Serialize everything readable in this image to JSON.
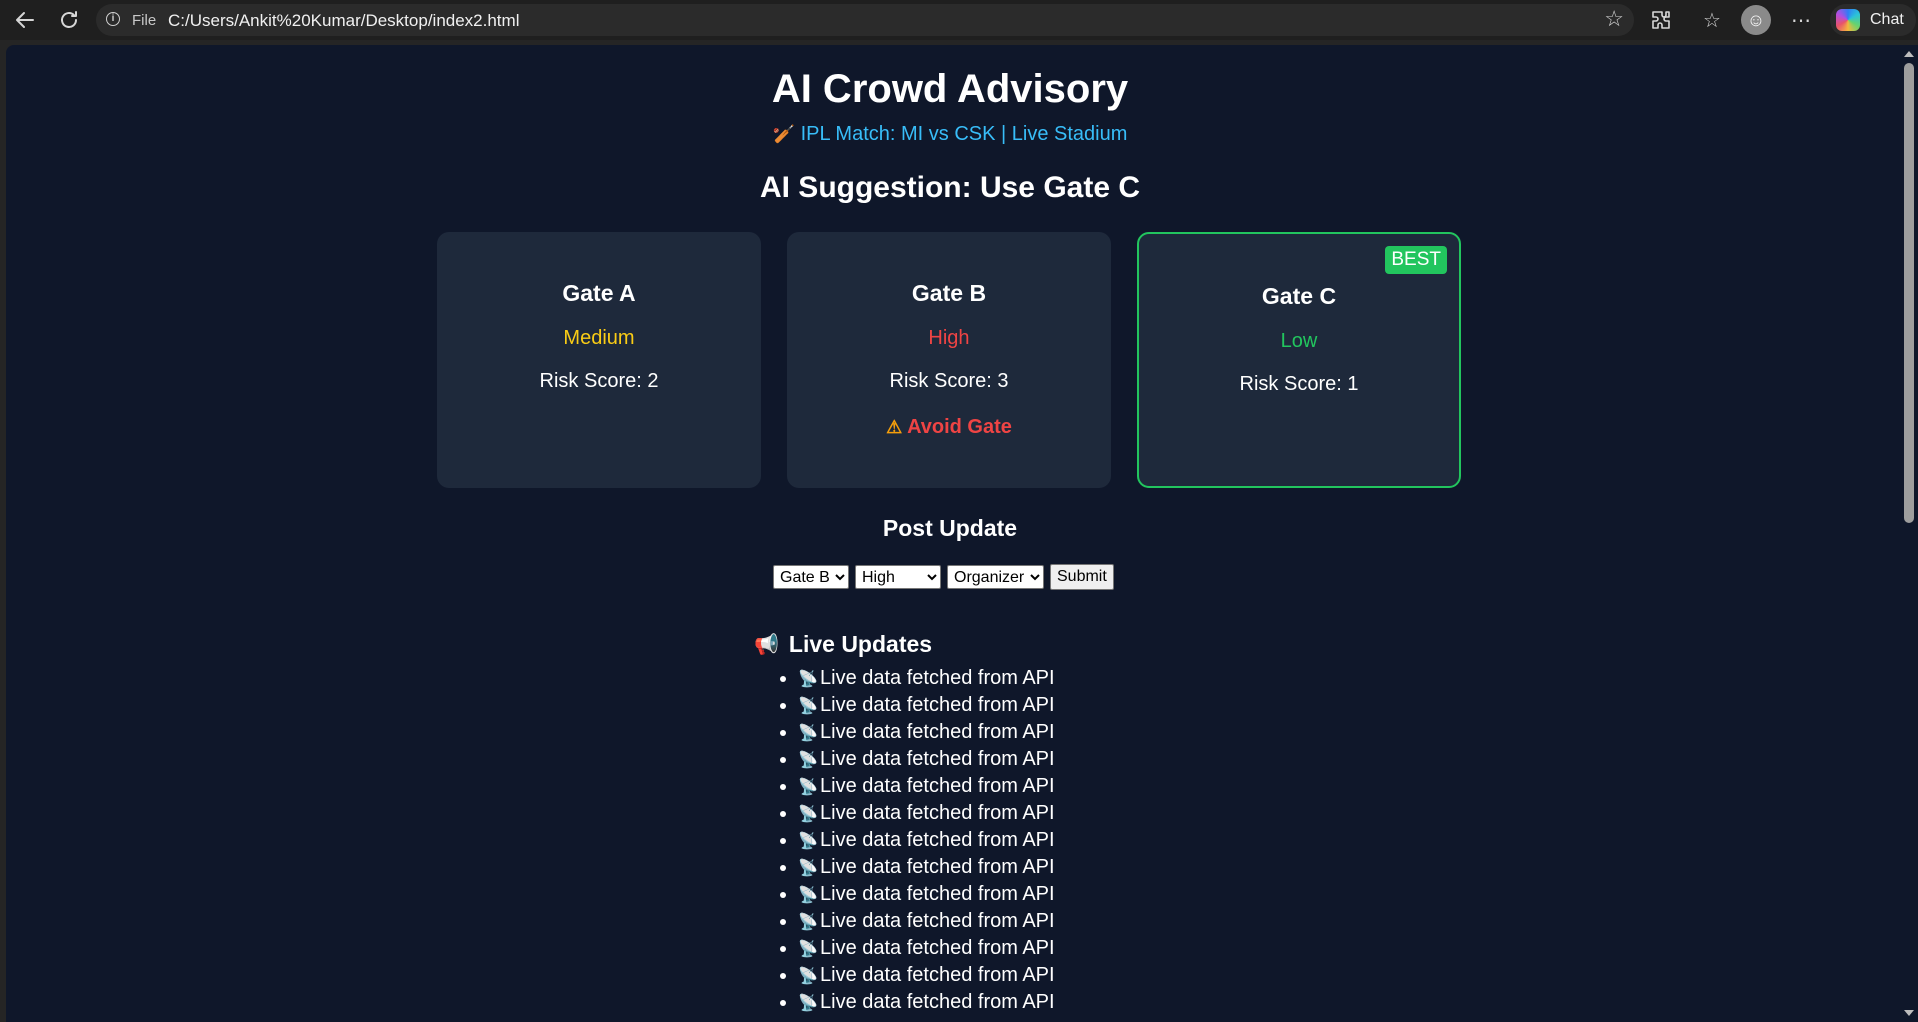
{
  "browser": {
    "file_label": "File",
    "url": "C:/Users/Ankit%20Kumar/Desktop/index2.html",
    "chat_label": "Chat"
  },
  "page": {
    "title": "AI Crowd Advisory",
    "subtitle": "IPL Match: MI vs CSK | Live Stadium",
    "subtitle_icon": "cricket-bat-icon",
    "suggestion": "AI Suggestion: Use Gate C"
  },
  "gates": [
    {
      "name": "Gate A",
      "level": "Medium",
      "level_color": "#facc15",
      "risk": "Risk Score: 2",
      "warning": "",
      "best": false
    },
    {
      "name": "Gate B",
      "level": "High",
      "level_color": "#ef4444",
      "risk": "Risk Score: 3",
      "warning": "Avoid Gate",
      "best": false
    },
    {
      "name": "Gate C",
      "level": "Low",
      "level_color": "#22c55e",
      "risk": "Risk Score: 1",
      "warning": "",
      "best": true,
      "badge": "BEST"
    }
  ],
  "colors": {
    "background": "#0f172a",
    "card": "#1e293b",
    "accent": "#38bdf8",
    "best_border": "#22c55e",
    "danger": "#ef4444"
  },
  "post_update": {
    "heading": "Post Update",
    "gate_select": "Gate B",
    "level_select": "High",
    "role_select": "Organizer",
    "submit_label": "Submit"
  },
  "live_updates": {
    "heading": "Live Updates",
    "items": [
      "Live data fetched from API",
      "Live data fetched from API",
      "Live data fetched from API",
      "Live data fetched from API",
      "Live data fetched from API",
      "Live data fetched from API",
      "Live data fetched from API",
      "Live data fetched from API",
      "Live data fetched from API",
      "Live data fetched from API",
      "Live data fetched from API",
      "Live data fetched from API",
      "Live data fetched from API"
    ]
  }
}
